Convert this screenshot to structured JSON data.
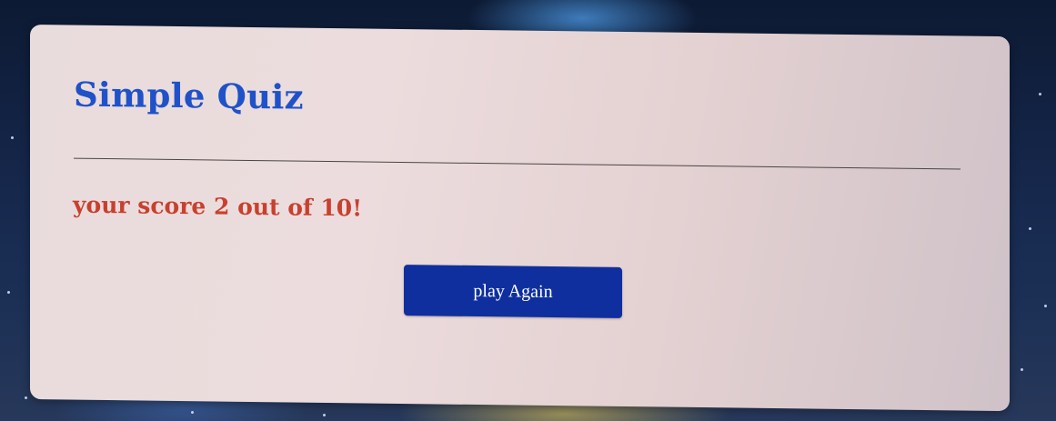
{
  "quiz": {
    "title": "Simple Quiz",
    "score_text": "your score 2 out of 10!",
    "play_again_label": "play Again"
  },
  "colors": {
    "title": "#1f52c8",
    "score": "#c8402e",
    "button": "#0f2f9e",
    "card": "#e9dcdc"
  }
}
